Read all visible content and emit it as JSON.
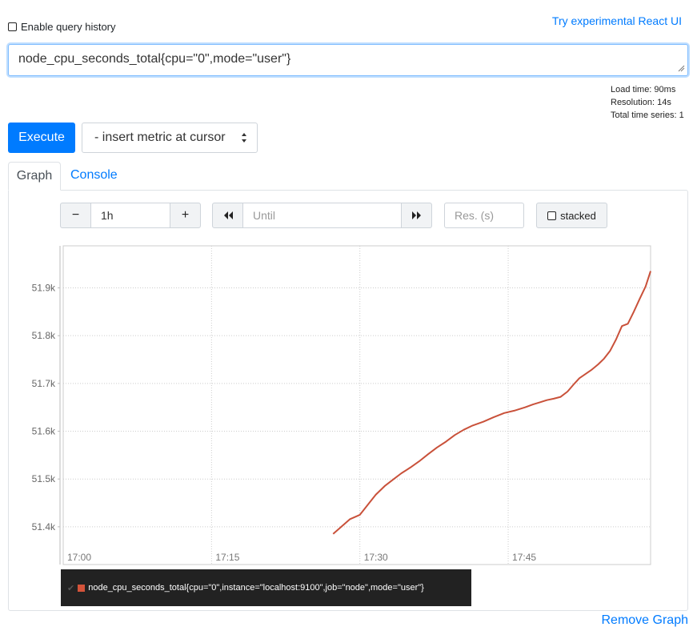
{
  "header": {
    "history_label": "Enable query history",
    "react_link": "Try experimental React UI"
  },
  "query": {
    "expression": "node_cpu_seconds_total{cpu=\"0\",mode=\"user\"}"
  },
  "stats": {
    "load_time": "Load time: 90ms",
    "resolution": "Resolution: 14s",
    "total_series": "Total time series: 1"
  },
  "toolbar": {
    "execute_label": "Execute",
    "metric_select_label": "- insert metric at cursor"
  },
  "tabs": {
    "graph": "Graph",
    "console": "Console"
  },
  "controls": {
    "range_value": "1h",
    "minus": "−",
    "plus": "+",
    "until_placeholder": "Until",
    "resolution_placeholder": "Res. (s)",
    "stacked_label": "stacked"
  },
  "chart_data": {
    "type": "line",
    "x_tick_labels": [
      "17:00",
      "17:15",
      "17:30",
      "17:45"
    ],
    "y_tick_labels": [
      "51.4k",
      "51.5k",
      "51.6k",
      "51.7k",
      "51.8k",
      "51.9k"
    ],
    "y_ticks": [
      51400,
      51500,
      51600,
      51700,
      51800,
      51900
    ],
    "x_range_minutes": [
      0,
      59.4
    ],
    "x_tick_minutes": [
      0,
      15,
      30,
      45
    ],
    "ylim": [
      51321,
      51988
    ],
    "grid": true,
    "series_color": "#c9513a",
    "series": [
      {
        "name": "node_cpu_seconds_total{cpu=\"0\",instance=\"localhost:9100\",job=\"node\",mode=\"user\"}",
        "x": [
          27.3,
          28,
          29,
          30,
          30.8,
          31.6,
          32.5,
          33.3,
          34.2,
          35.1,
          36,
          36.9,
          37.8,
          38.7,
          39.6,
          40.5,
          41.4,
          42.5,
          43.5,
          44.6,
          45.6,
          46.7,
          47.5,
          48.3,
          48.9,
          49.6,
          50.3,
          51.0,
          51.7,
          52.2,
          52.7,
          53.4,
          54.1,
          54.7,
          55.3,
          55.9,
          56.5,
          57.1,
          57.7,
          58.3,
          58.9,
          59.4
        ],
        "values": [
          51385,
          51398,
          51416,
          51425,
          51446,
          51467,
          51485,
          51498,
          51512,
          51524,
          51537,
          51552,
          51566,
          51578,
          51592,
          51603,
          51612,
          51620,
          51629,
          51638,
          51643,
          51650,
          51656,
          51661,
          51665,
          51668,
          51672,
          51683,
          51700,
          51711,
          51718,
          51728,
          51740,
          51752,
          51768,
          51792,
          51820,
          51825,
          51850,
          51877,
          51903,
          51935
        ]
      }
    ]
  },
  "legend": {
    "check": "✔",
    "series_label": "node_cpu_seconds_total{cpu=\"0\",instance=\"localhost:9100\",job=\"node\",mode=\"user\"}"
  },
  "footer": {
    "remove_graph": "Remove Graph"
  }
}
